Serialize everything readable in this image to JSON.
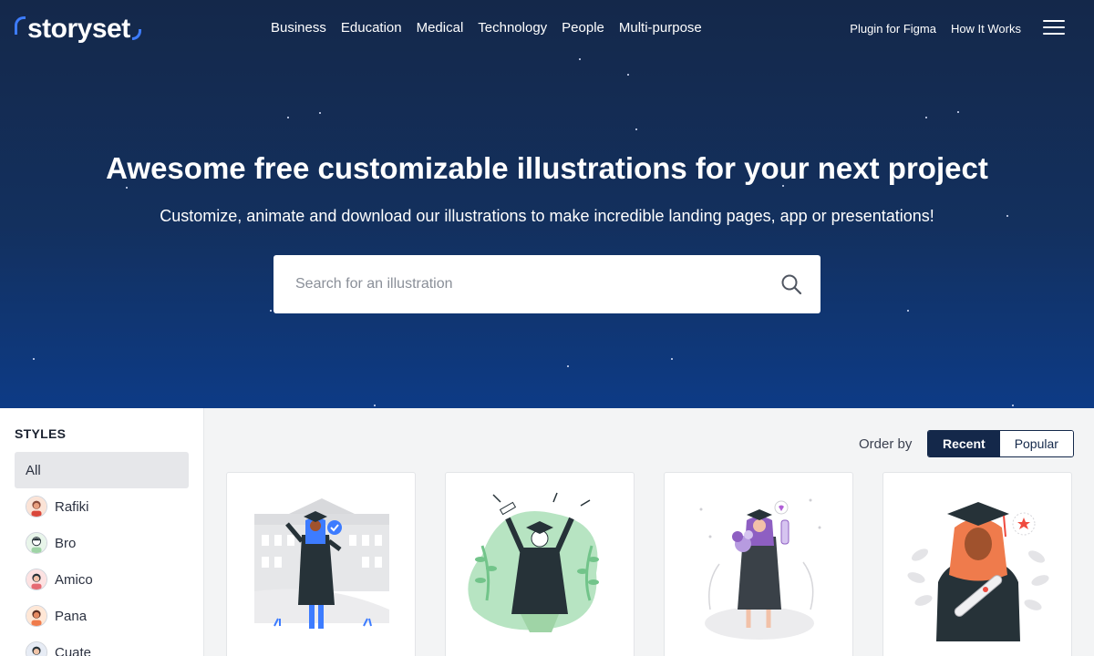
{
  "brand": {
    "name": "storyset"
  },
  "nav": {
    "categories": [
      "Business",
      "Education",
      "Medical",
      "Technology",
      "People",
      "Multi-purpose"
    ],
    "right": [
      "Plugin for Figma",
      "How It Works"
    ]
  },
  "hero": {
    "title": "Awesome free customizable illustrations for your next project",
    "subtitle": "Customize, animate and download our illustrations to make incredible landing pages, app or presentations!"
  },
  "search": {
    "placeholder": "Search for an illustration"
  },
  "sidebar": {
    "title": "STYLES",
    "items": [
      {
        "label": "All",
        "active": true
      },
      {
        "label": "Rafiki",
        "active": false
      },
      {
        "label": "Bro",
        "active": false
      },
      {
        "label": "Amico",
        "active": false
      },
      {
        "label": "Pana",
        "active": false
      },
      {
        "label": "Cuate",
        "active": false
      }
    ]
  },
  "order": {
    "label": "Order by",
    "options": [
      {
        "label": "Recent",
        "active": true
      },
      {
        "label": "Popular",
        "active": false
      }
    ]
  },
  "colors": {
    "accent": "#3d7cff",
    "navy": "#14284a",
    "mint": "#b7e4c2",
    "purple": "#7e57c2",
    "orange": "#ef7b4c"
  },
  "cards": [
    {
      "icon": "graduation-illustration-1"
    },
    {
      "icon": "graduation-illustration-2"
    },
    {
      "icon": "graduation-illustration-3"
    },
    {
      "icon": "graduation-illustration-4"
    }
  ]
}
